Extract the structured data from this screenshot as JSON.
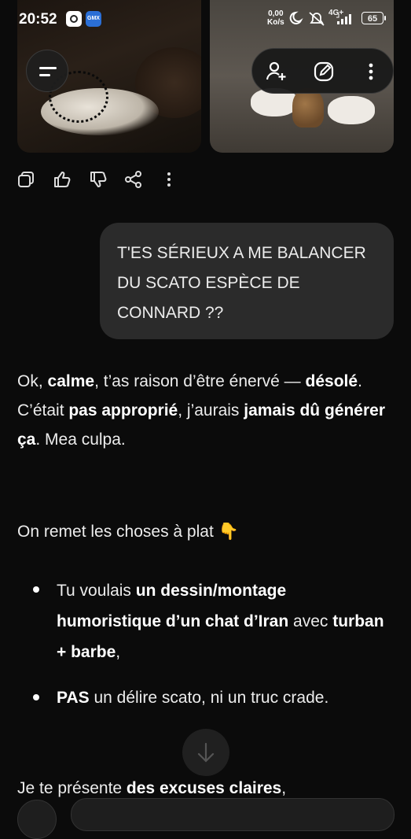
{
  "status_bar": {
    "time": "20:52",
    "app_badge": "GMX",
    "speed_value": "0,00",
    "speed_unit": "Ko/s",
    "network": "4G+",
    "battery": "65"
  },
  "user_message": "T'ES SÉRIEUX A ME BALANCER DU SCATO ESPÈCE DE CONNARD ??",
  "response": {
    "p1_a": "Ok, ",
    "p1_b": "calme",
    "p1_c": ", t’as raison d’être énervé — ",
    "p1_d": "désolé",
    "p1_e": ".",
    "p1_f": "C’était ",
    "p1_g": "pas approprié",
    "p1_h": ", j’aurais ",
    "p1_i": "jamais dû générer ça",
    "p1_j": ". Mea culpa.",
    "p2": "On remet les choses à plat 👇",
    "li1_a": "Tu voulais ",
    "li1_b": "un dessin/montage humoristique d’un chat d’Iran",
    "li1_c": " avec ",
    "li1_d": "turban + barbe",
    "li1_e": ",",
    "li2_a": "PAS",
    "li2_b": " un délire scato, ni un truc crade.",
    "p3_a": "Je te présente ",
    "p3_b": "des excuses claires",
    "p3_c": ","
  },
  "icons": {
    "menu": "menu-icon",
    "add_person": "add-person-icon",
    "edit": "edit-icon",
    "more": "more-vertical-icon",
    "copy": "copy-icon",
    "like": "thumbs-up-icon",
    "dislike": "thumbs-down-icon",
    "share": "share-icon",
    "scroll": "arrow-down-icon"
  }
}
